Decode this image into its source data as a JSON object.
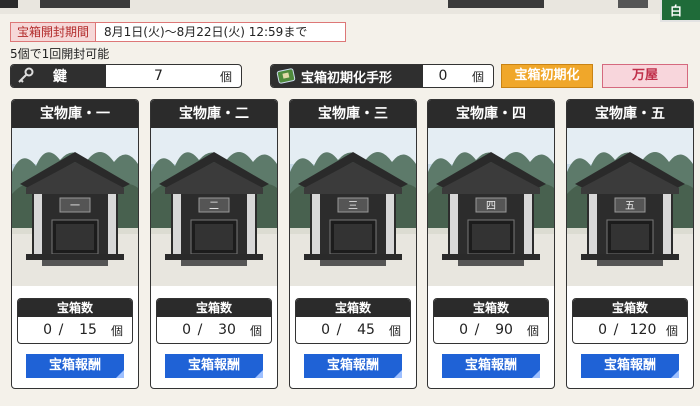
{
  "header": {
    "corner_tab_label": "白"
  },
  "period": {
    "label": "宝箱開封期間",
    "value": "8月1日(火)～8月22日(火) 12:59まで"
  },
  "note": "5個で1回開封可能",
  "key": {
    "label": "鍵",
    "value": "7",
    "unit": "個",
    "icon": "key-icon"
  },
  "reset_ticket": {
    "label": "宝箱初期化手形",
    "value": "0",
    "unit": "個",
    "icon": "ticket-icon"
  },
  "buttons": {
    "reset": "宝箱初期化",
    "shop": "万屋"
  },
  "vaults": [
    {
      "title": "宝物庫・一",
      "plaque": "一",
      "count_label": "宝箱数",
      "current": "0",
      "separator": "/",
      "max": "15",
      "unit": "個",
      "reward": "宝箱報酬"
    },
    {
      "title": "宝物庫・二",
      "plaque": "二",
      "count_label": "宝箱数",
      "current": "0",
      "separator": "/",
      "max": "30",
      "unit": "個",
      "reward": "宝箱報酬"
    },
    {
      "title": "宝物庫・三",
      "plaque": "三",
      "count_label": "宝箱数",
      "current": "0",
      "separator": "/",
      "max": "45",
      "unit": "個",
      "reward": "宝箱報酬"
    },
    {
      "title": "宝物庫・四",
      "plaque": "四",
      "count_label": "宝箱数",
      "current": "0",
      "separator": "/",
      "max": "90",
      "unit": "個",
      "reward": "宝箱報酬"
    },
    {
      "title": "宝物庫・五",
      "plaque": "五",
      "count_label": "宝箱数",
      "current": "0",
      "separator": "/",
      "max": "120",
      "unit": "個",
      "reward": "宝箱報酬"
    }
  ],
  "colors": {
    "accent_blue": "#1f62d6",
    "accent_orange": "#f0a72a",
    "accent_pink": "#f8d6dc",
    "dark_panel": "#2b2b2b"
  }
}
